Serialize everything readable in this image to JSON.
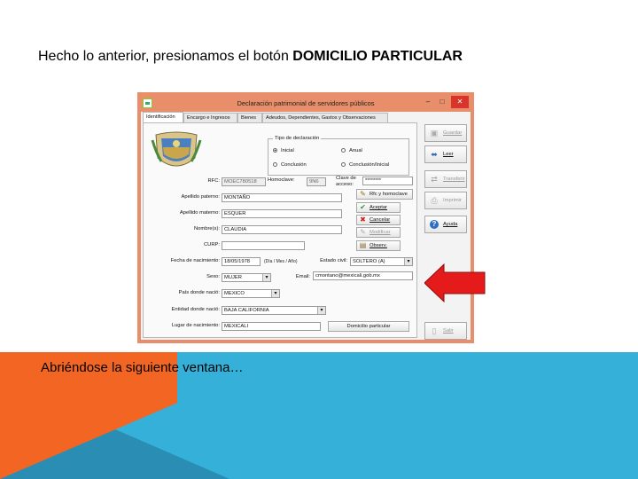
{
  "slide": {
    "title_prefix": "Hecho lo anterior, presionamos el botón ",
    "title_bold": "DOMICILIO PARTICULAR",
    "caption": "Abriéndose la siguiente ventana…"
  },
  "window": {
    "title": "Declaración patrimonial de servidores públicos",
    "controls": {
      "minimize": "–",
      "maximize": "□",
      "close": "✕"
    },
    "tabs": [
      {
        "label": "Identificación"
      },
      {
        "label": "Encargo e Ingresos"
      },
      {
        "label": "Bienes"
      },
      {
        "label": "Adeudos, Dependientes, Gastos y Observaciones"
      }
    ],
    "tipo": {
      "legend": "Tipo de declaración",
      "options": [
        "Inicial",
        "Anual",
        "Conclusión",
        "Conclusión/Inicial"
      ],
      "selected": "Inicial"
    },
    "fields": {
      "rfc_label": "RFC:",
      "rfc_value": "MOEC780518",
      "homoclave_label": "Homoclave:",
      "homoclave_value": "9N6",
      "clave_label": "Clave de acceso:",
      "clave_value": "********",
      "apellido_paterno_label": "Apellido paterno:",
      "apellido_paterno_value": "MONTAÑO",
      "apellido_materno_label": "Apellido materno:",
      "apellido_materno_value": "ESQUER",
      "nombres_label": "Nombre(s):",
      "nombres_value": "CLAUDIA",
      "curp_label": "CURP:",
      "curp_value": "",
      "fecha_label": "Fecha de nacimiento:",
      "fecha_value": "18/05/1978",
      "fecha_hint": "(Día / Mes / Año)",
      "estado_civil_label": "Estado civil:",
      "estado_civil_value": "SOLTERO (A)",
      "sexo_label": "Sexo:",
      "sexo_value": "MUJER",
      "email_label": "Email:",
      "email_value": "cmontano@mexicali.gob.mx",
      "pais_label": "País donde nació:",
      "pais_value": "MEXICO",
      "entidad_label": "Entidad donde nació:",
      "entidad_value": "BAJA CALIFORNIA",
      "lugar_label": "Lugar de nacimiento:",
      "lugar_value": "MEXICALI"
    },
    "buttons": {
      "rfc_homoclave": "Rfc y homoclave",
      "aceptar": "Aceptar",
      "cancelar": "Cancelar",
      "modificar": "Modificar",
      "observ": "Observ.",
      "domicilio": "Domicilio particular"
    },
    "side_buttons": {
      "guardar": "Guardar",
      "leer": "Leer",
      "transferir": "Transferir",
      "imprimir": "Imprimir",
      "ayuda": "Ayuda",
      "salir": "Salir"
    }
  },
  "colors": {
    "window_border": "#e98e6a",
    "band_blue": "#35b1d9",
    "band_orange": "#f26522",
    "arrow_red": "#e51a1a"
  }
}
